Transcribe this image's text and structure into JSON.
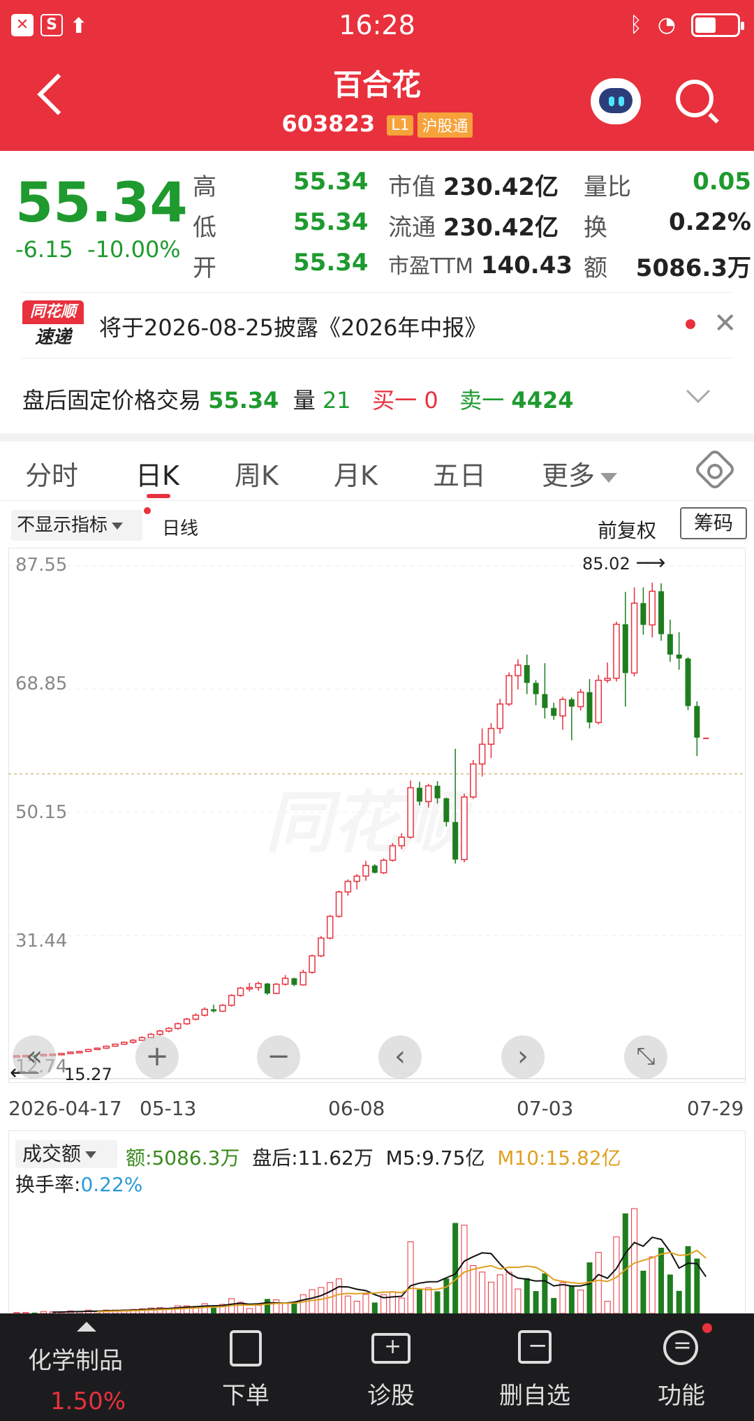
{
  "status": {
    "time": "16:28"
  },
  "header": {
    "title": "百合花",
    "code": "603823",
    "tag_level": "L1",
    "tag_connect": "沪股通"
  },
  "quote": {
    "price": "55.34",
    "change": "-6.15",
    "change_pct": "-10.00%",
    "high_label": "高",
    "high": "55.34",
    "low_label": "低",
    "low": "55.34",
    "open_label": "开",
    "open": "55.34",
    "mktcap_label": "市值",
    "mktcap": "230.42亿",
    "float_label": "流通",
    "float": "230.42亿",
    "pe_label": "市盈TTM",
    "pe": "140.43",
    "vol_ratio_label": "量比",
    "vol_ratio": "0.05",
    "turnover_label": "换",
    "turnover": "0.22%",
    "amount_label": "额",
    "amount": "5086.3万"
  },
  "news": {
    "logo_top": "同花顺",
    "logo_bottom": "速递",
    "text": "将于2026-08-25披露《2026年中报》"
  },
  "after_hours": {
    "label": "盘后固定价格交易",
    "price": "55.34",
    "vol_label": "量",
    "vol": "21",
    "buy_label": "买一",
    "buy": "0",
    "sell_label": "卖一",
    "sell": "4424"
  },
  "tabs": [
    "分时",
    "日K",
    "周K",
    "月K",
    "五日",
    "更多"
  ],
  "active_tab": "日K",
  "toolbar": {
    "indicator": "不显示指标",
    "line_type": "日线",
    "adjust": "前复权",
    "chips": "筹码"
  },
  "chart_data": {
    "type": "candlestick",
    "y_ticks": [
      "87.55",
      "68.85",
      "50.15",
      "31.44",
      "12.74"
    ],
    "high_marker": "85.02",
    "low_marker": "15.27",
    "dates": [
      "2026-04-17",
      "05-13",
      "06-08",
      "07-03",
      "07-29"
    ],
    "reference_line": 56.0,
    "ylim": [
      12.74,
      87.55
    ],
    "candles": [
      [
        13.2,
        13.3,
        13.1,
        13.25
      ],
      [
        13.25,
        13.4,
        13.2,
        13.3
      ],
      [
        13.3,
        13.4,
        13.2,
        13.28
      ],
      [
        13.28,
        13.5,
        13.2,
        13.45
      ],
      [
        13.4,
        13.6,
        13.3,
        13.5
      ],
      [
        13.5,
        13.7,
        13.4,
        13.6
      ],
      [
        13.6,
        13.9,
        13.5,
        13.8
      ],
      [
        13.8,
        14.0,
        13.7,
        13.9
      ],
      [
        13.9,
        14.3,
        13.8,
        14.2
      ],
      [
        14.2,
        14.5,
        14.1,
        14.4
      ],
      [
        14.4,
        14.8,
        14.3,
        14.7
      ],
      [
        14.7,
        15.1,
        14.6,
        15.0
      ],
      [
        15.0,
        15.4,
        14.9,
        15.3
      ],
      [
        15.3,
        15.8,
        15.1,
        15.6
      ],
      [
        15.6,
        16.2,
        15.5,
        16.0
      ],
      [
        16.0,
        16.7,
        15.9,
        16.5
      ],
      [
        16.5,
        17.2,
        16.3,
        17.0
      ],
      [
        17.0,
        17.6,
        16.8,
        17.4
      ],
      [
        17.4,
        18.3,
        17.2,
        18.1
      ],
      [
        18.1,
        19.0,
        17.9,
        18.8
      ],
      [
        18.8,
        19.7,
        18.6,
        19.4
      ],
      [
        19.4,
        20.6,
        19.2,
        20.3
      ],
      [
        20.3,
        21.0,
        19.8,
        20.0
      ],
      [
        20.0,
        21.1,
        19.9,
        20.9
      ],
      [
        20.9,
        22.6,
        20.7,
        22.4
      ],
      [
        22.4,
        23.7,
        22.2,
        23.5
      ],
      [
        23.5,
        24.3,
        23.0,
        23.6
      ],
      [
        23.6,
        24.5,
        23.1,
        24.2
      ],
      [
        24.2,
        24.3,
        22.5,
        22.7
      ],
      [
        22.7,
        24.3,
        22.6,
        24.1
      ],
      [
        24.1,
        25.5,
        23.9,
        25.0
      ],
      [
        25.0,
        25.1,
        23.8,
        24.0
      ],
      [
        24.0,
        26.3,
        23.9,
        25.9
      ],
      [
        25.9,
        28.6,
        25.7,
        28.4
      ],
      [
        28.4,
        31.4,
        28.2,
        31.1
      ],
      [
        31.1,
        34.6,
        30.9,
        34.4
      ],
      [
        34.4,
        38.3,
        34.2,
        38.1
      ],
      [
        38.1,
        40.0,
        37.5,
        39.7
      ],
      [
        39.7,
        40.8,
        38.5,
        40.5
      ],
      [
        40.5,
        42.8,
        39.8,
        42.1
      ],
      [
        42.1,
        42.3,
        40.9,
        41.0
      ],
      [
        41.0,
        43.2,
        40.8,
        42.9
      ],
      [
        42.9,
        45.5,
        42.7,
        45.1
      ],
      [
        45.1,
        47.0,
        44.6,
        46.4
      ],
      [
        46.4,
        55.0,
        46.2,
        53.9
      ],
      [
        53.9,
        54.8,
        51.2,
        51.8
      ],
      [
        51.8,
        54.5,
        50.9,
        54.2
      ],
      [
        54.2,
        54.9,
        51.5,
        52.3
      ],
      [
        52.3,
        52.4,
        48.0,
        48.7
      ],
      [
        48.7,
        59.8,
        42.4,
        43.0
      ],
      [
        43.0,
        53.0,
        42.6,
        52.5
      ],
      [
        52.5,
        58.1,
        52.2,
        57.5
      ],
      [
        57.5,
        62.9,
        55.6,
        60.5
      ],
      [
        60.5,
        63.7,
        58.4,
        62.9
      ],
      [
        62.9,
        67.4,
        62.1,
        66.6
      ],
      [
        66.6,
        71.4,
        66.3,
        70.9
      ],
      [
        70.9,
        73.4,
        68.8,
        72.5
      ],
      [
        72.5,
        74.1,
        68.1,
        69.8
      ],
      [
        69.8,
        70.2,
        66.4,
        68.1
      ],
      [
        68.1,
        72.8,
        64.4,
        66.0
      ],
      [
        66.0,
        66.8,
        64.2,
        64.8
      ],
      [
        64.8,
        67.7,
        62.7,
        67.3
      ],
      [
        67.3,
        67.6,
        61.1,
        66.2
      ],
      [
        66.2,
        68.9,
        65.6,
        68.4
      ],
      [
        68.4,
        70.4,
        62.9,
        63.8
      ],
      [
        63.8,
        71.0,
        63.5,
        70.2
      ],
      [
        70.2,
        72.9,
        69.8,
        70.5
      ],
      [
        70.5,
        79.1,
        70.0,
        78.7
      ],
      [
        78.7,
        83.6,
        66.2,
        71.3
      ],
      [
        71.3,
        84.3,
        70.8,
        81.9
      ],
      [
        81.9,
        84.3,
        77.1,
        78.6
      ],
      [
        78.6,
        85.02,
        76.7,
        83.7
      ],
      [
        83.7,
        84.9,
        76.2,
        77.2
      ],
      [
        77.2,
        79.4,
        73.0,
        74.1
      ],
      [
        74.1,
        77.5,
        71.8,
        73.5
      ],
      [
        73.5,
        73.7,
        65.7,
        66.3
      ],
      [
        66.3,
        67.0,
        58.7,
        61.5
      ],
      [
        61.5,
        61.5,
        61.5,
        61.5
      ]
    ]
  },
  "volume": {
    "selector": "成交额",
    "amount_label": "额:",
    "amount": "5086.3万",
    "after_label": "盘后:",
    "after": "11.62万",
    "m5_label": "M5:",
    "m5": "9.75亿",
    "m10_label": "M10:",
    "m10": "15.82亿",
    "turnover_label": "换手率:",
    "turnover": "0.22%"
  },
  "bottom_nav": {
    "sector": "化学制品",
    "sector_pct": "1.50%",
    "items": [
      "下单",
      "诊股",
      "删自选",
      "功能"
    ]
  },
  "colors": {
    "up": "#e8313d",
    "down": "#1e7d1e",
    "brand": "#e8313d"
  }
}
